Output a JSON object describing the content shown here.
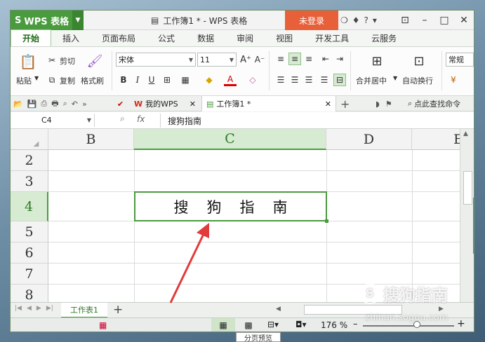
{
  "app": {
    "name": "WPS 表格",
    "document_title": "工作簿1 * - WPS 表格",
    "login_label": "未登录"
  },
  "menu": {
    "tabs": [
      "开始",
      "插入",
      "页面布局",
      "公式",
      "数据",
      "审阅",
      "视图",
      "开发工具",
      "云服务"
    ]
  },
  "ribbon": {
    "paste": "粘贴",
    "cut": "剪切",
    "copy": "复制",
    "format_painter": "格式刷",
    "font_name": "宋体",
    "font_size": "11",
    "bold": "B",
    "italic": "I",
    "underline": "U",
    "merge_center": "合并居中",
    "wrap_text": "自动换行",
    "number_format": "常规"
  },
  "doc_tabs": [
    {
      "label": "我的WPS"
    },
    {
      "label": "工作簿1 *"
    }
  ],
  "search_label": "点此查找命令",
  "formula_bar": {
    "name_box": "C4",
    "fx": "fx",
    "content": "搜狗指南"
  },
  "grid": {
    "columns": [
      "B",
      "C",
      "D",
      "E"
    ],
    "rows": [
      "2",
      "3",
      "4",
      "5",
      "6",
      "7",
      "8"
    ],
    "selected_cell_text": "搜狗指南"
  },
  "sheets": {
    "active": "工作表1",
    "add": "+"
  },
  "status": {
    "zoom": "176 %"
  },
  "tooltip": "分页预览",
  "watermark": {
    "brand": "搜狗指南",
    "url": "zhinan.sogou.com"
  },
  "colors": {
    "brand_green": "#4a9a3e",
    "login_orange": "#e8603a",
    "arrow_red": "#e23b3b"
  }
}
